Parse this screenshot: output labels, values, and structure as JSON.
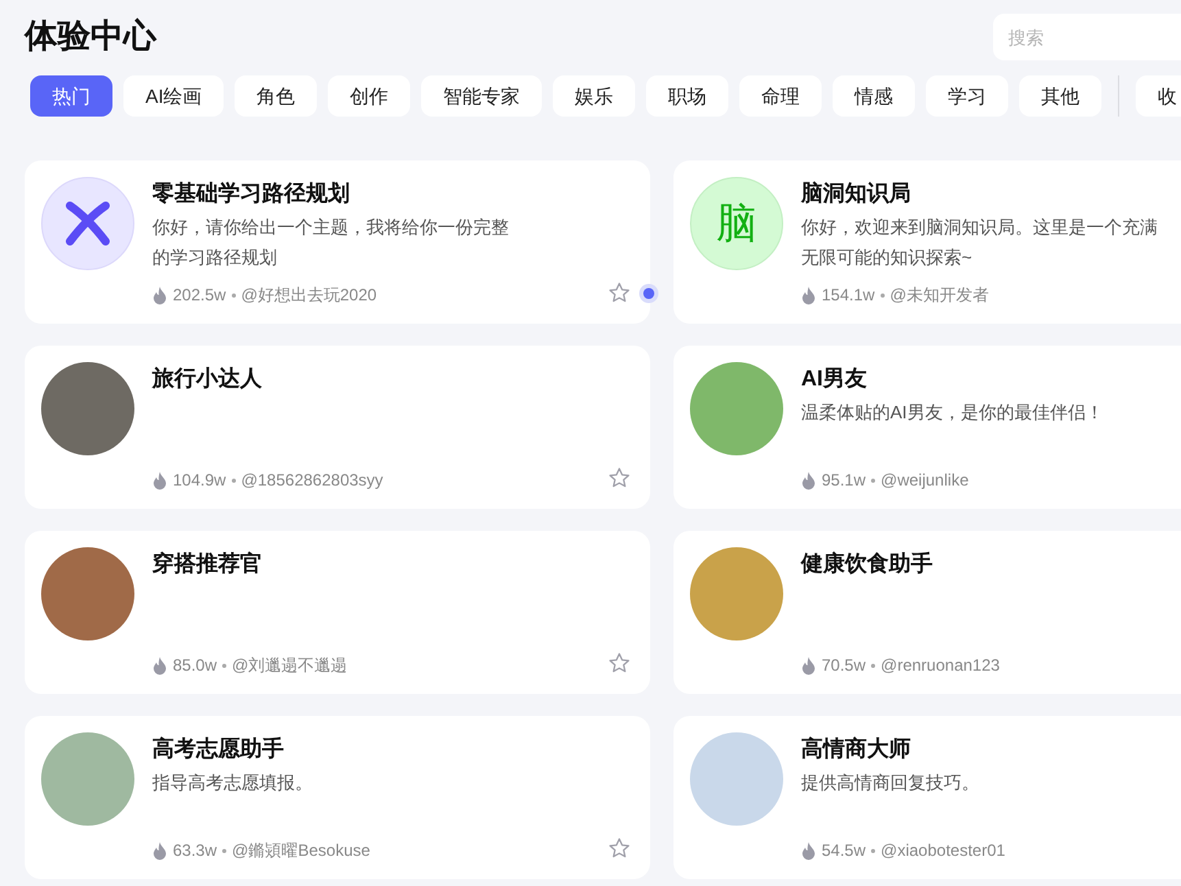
{
  "header": {
    "title": "体验中心",
    "search": {
      "placeholder": "搜索"
    }
  },
  "tabs": [
    {
      "label": "热门",
      "selected": true
    },
    {
      "label": "AI绘画",
      "selected": false
    },
    {
      "label": "角色",
      "selected": false
    },
    {
      "label": "创作",
      "selected": false
    },
    {
      "label": "智能专家",
      "selected": false
    },
    {
      "label": "娱乐",
      "selected": false
    },
    {
      "label": "职场",
      "selected": false
    },
    {
      "label": "命理",
      "selected": false
    },
    {
      "label": "情感",
      "selected": false
    },
    {
      "label": "学习",
      "selected": false
    },
    {
      "label": "其他",
      "selected": false
    }
  ],
  "extra_tab": {
    "label": "收"
  },
  "cards": [
    {
      "title": "零基础学习路径规划",
      "description": "你好，请你给出一个主题，我将给你一份完整的学习路径规划",
      "heat": "202.5w",
      "author": "@好想出去玩2020",
      "avatar": {
        "kind": "logo"
      }
    },
    {
      "title": "脑洞知识局",
      "description": "你好，欢迎来到脑洞知识局。这里是一个充满无限可能的知识探索~",
      "heat": "154.1w",
      "author": "@未知开发者",
      "avatar": {
        "kind": "letter",
        "text": "脑"
      }
    },
    {
      "title": "旅行小达人",
      "heat": "104.9w",
      "author": "@18562862803syy",
      "avatar": {
        "kind": "image"
      }
    },
    {
      "title": "AI男友",
      "description": "温柔体贴的AI男友，是你的最佳伴侣！",
      "heat": "95.1w",
      "author": "@weijunlike",
      "avatar": {
        "kind": "image"
      }
    },
    {
      "title": "穿搭推荐官",
      "heat": "85.0w",
      "author": "@刘邋遢不邋遢",
      "avatar": {
        "kind": "image"
      }
    },
    {
      "title": "健康饮食助手",
      "heat": "70.5w",
      "author": "@renruonan123",
      "avatar": {
        "kind": "image"
      }
    },
    {
      "title": "高考志愿助手",
      "description": "指导高考志愿填报。",
      "heat": "63.3w",
      "author": "@鏅熲曜Besokuse",
      "avatar": {
        "kind": "image"
      }
    },
    {
      "title": "高情商大师",
      "description": "提供高情商回复技巧。",
      "heat": "54.5w",
      "author": "@xiaobotester01",
      "avatar": {
        "kind": "image"
      }
    }
  ]
}
